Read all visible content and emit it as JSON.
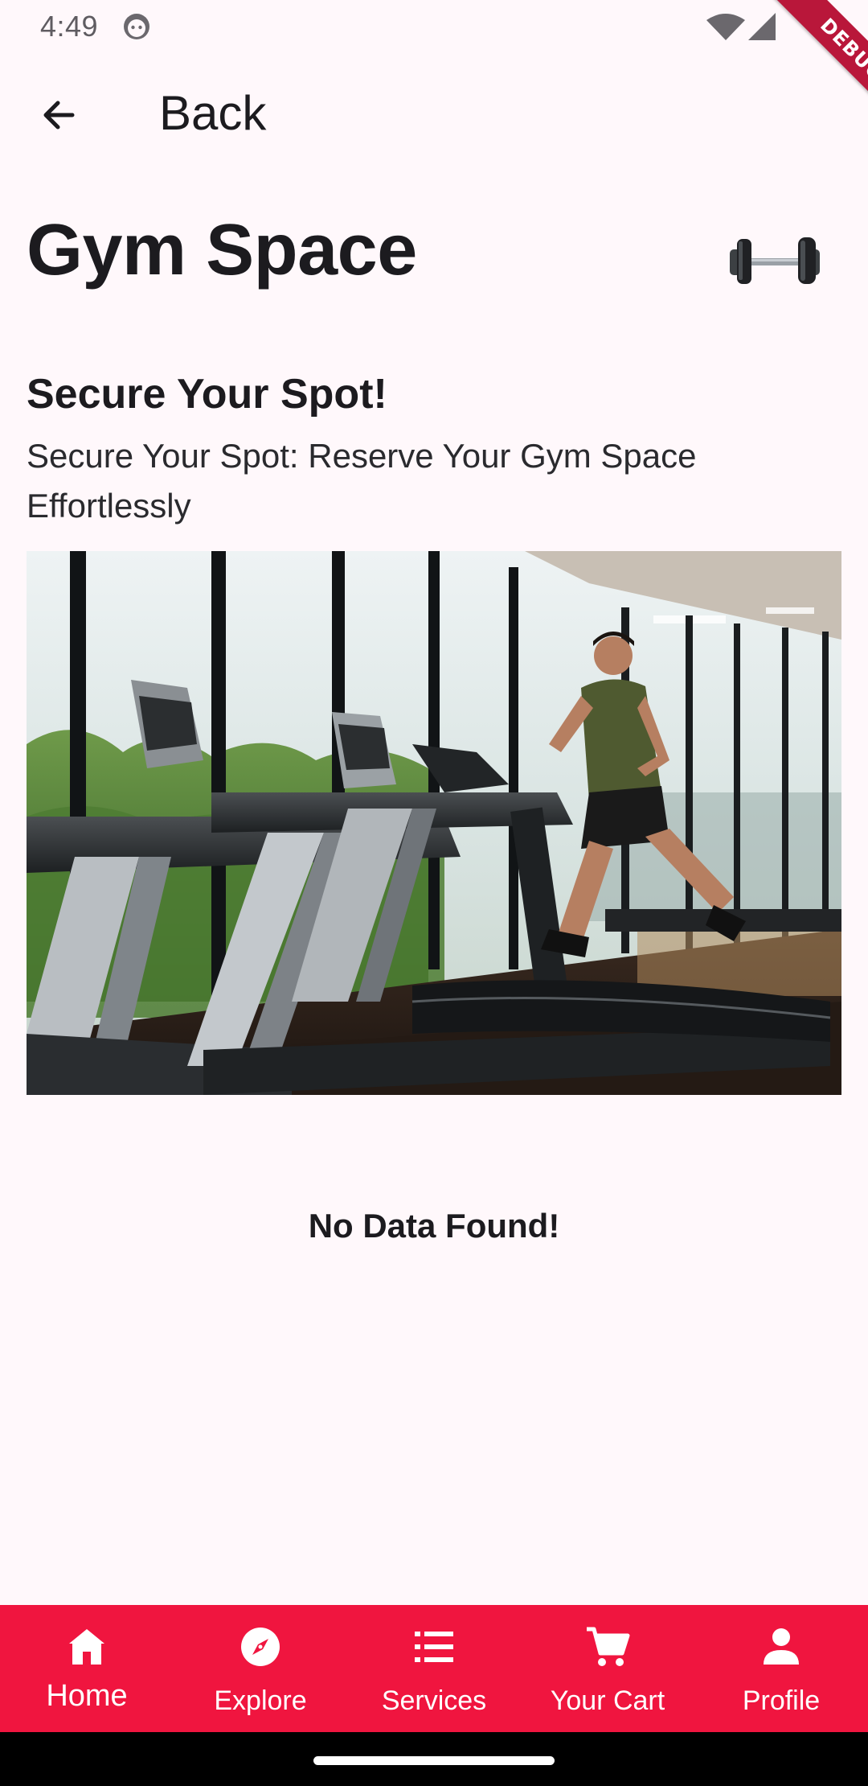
{
  "status_bar": {
    "time": "4:49",
    "debug_label": "DEBUG"
  },
  "app_bar": {
    "back_label": "Back"
  },
  "page": {
    "title": "Gym Space",
    "section_title": "Secure Your Spot!",
    "section_subtitle": "Secure Your Spot: Reserve Your Gym Space Effortlessly",
    "empty_message": "No Data Found!"
  },
  "bottom_nav": {
    "accent_color": "#f0153f",
    "items": [
      {
        "label": "Home",
        "icon": "home-icon",
        "active": true
      },
      {
        "label": "Explore",
        "icon": "compass-icon",
        "active": false
      },
      {
        "label": "Services",
        "icon": "list-icon",
        "active": false
      },
      {
        "label": "Your Cart",
        "icon": "cart-icon",
        "active": false
      },
      {
        "label": "Profile",
        "icon": "person-icon",
        "active": false
      }
    ]
  }
}
